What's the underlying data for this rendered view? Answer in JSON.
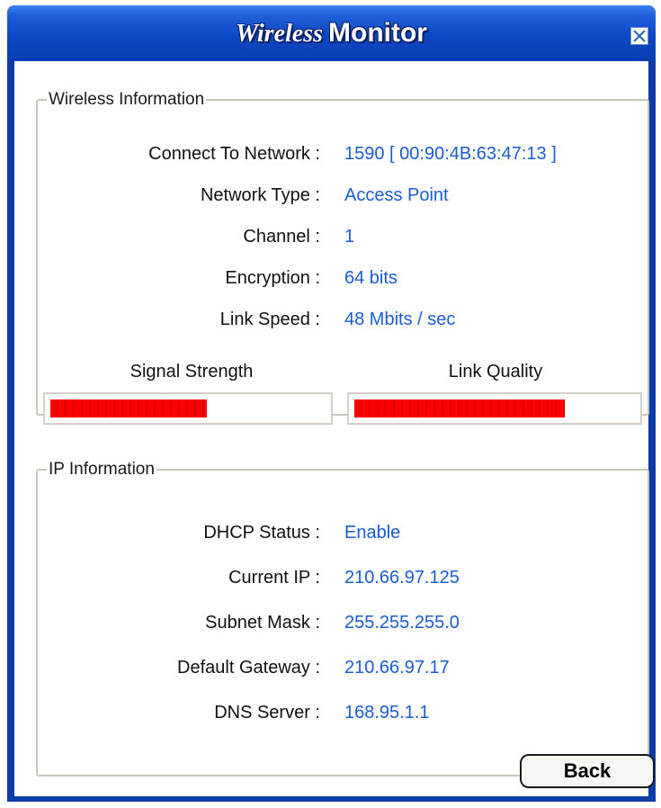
{
  "window": {
    "title_part1": "Wireless",
    "title_part2": "Monitor"
  },
  "wireless_info": {
    "legend": "Wireless Information",
    "fields": [
      {
        "label": "Connect To Network :",
        "value": "1590 [ 00:90:4B:63:47:13 ]"
      },
      {
        "label": "Network Type :",
        "value": "Access Point"
      },
      {
        "label": "Channel :",
        "value": "1"
      },
      {
        "label": "Encryption :",
        "value": "64 bits"
      },
      {
        "label": "Link Speed :",
        "value": "48 Mbits / sec"
      }
    ],
    "signal_strength": {
      "label": "Signal Strength",
      "level": 0.57
    },
    "link_quality": {
      "label": "Link Quality",
      "level": 0.75
    }
  },
  "ip_info": {
    "legend": "IP Information",
    "fields": [
      {
        "label": "DHCP Status :",
        "value": "Enable"
      },
      {
        "label": "Current IP :",
        "value": "210.66.97.125"
      },
      {
        "label": "Subnet Mask :",
        "value": "255.255.255.0"
      },
      {
        "label": "Default Gateway :",
        "value": "210.66.97.17"
      },
      {
        "label": "DNS Server :",
        "value": "168.95.1.1"
      }
    ]
  },
  "buttons": {
    "back": "Back"
  },
  "colors": {
    "title_bar": "#0d48c4",
    "value_text": "#1b5cd1",
    "meter_fill": "#ff0000"
  }
}
